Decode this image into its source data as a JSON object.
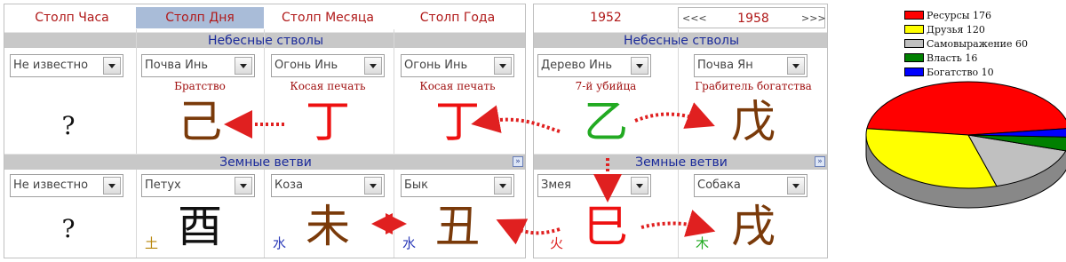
{
  "pillars": [
    {
      "title": "Столп Часа",
      "stem_select": "Не известно",
      "stem_relation": "",
      "stem_glyph": "?",
      "stem_color": "#111111",
      "branch_select": "Не известно",
      "branch_glyph": "?",
      "branch_color": "#111111",
      "element": "",
      "element_color": ""
    },
    {
      "title": "Столп Дня",
      "stem_select": "Почва Инь",
      "stem_relation": "Братство",
      "stem_glyph": "己",
      "stem_color": "#7a3a0a",
      "branch_select": "Петух",
      "branch_glyph": "酉",
      "branch_color": "#111111",
      "element": "土",
      "element_color": "#b8860b"
    },
    {
      "title": "Столп Месяца",
      "stem_select": "Огонь Инь",
      "stem_relation": "Косая печать",
      "stem_glyph": "丁",
      "stem_color": "#ee1111",
      "branch_select": "Коза",
      "branch_glyph": "未",
      "branch_color": "#7a3a0a",
      "element": "水",
      "element_color": "#2a3ab8"
    },
    {
      "title": "Столп Года",
      "stem_select": "Огонь Инь",
      "stem_relation": "Косая печать",
      "stem_glyph": "丁",
      "stem_color": "#ee1111",
      "branch_select": "Бык",
      "branch_glyph": "丑",
      "branch_color": "#7a3a0a",
      "element": "水",
      "element_color": "#2a3ab8"
    }
  ],
  "left_bands": {
    "heavenly": "Небесные стволы",
    "earthly": "Земные ветви"
  },
  "right": {
    "year_a": "1952",
    "year_b": "1958",
    "prev": "<<<",
    "next": ">>>",
    "heavenly": "Небесные стволы",
    "earthly": "Земные ветви",
    "cols": [
      {
        "stem_select": "Дерево Инь",
        "stem_relation": "7-й убийца",
        "stem_glyph": "乙",
        "stem_color": "#22aa22",
        "branch_select": "Змея",
        "branch_glyph": "巳",
        "branch_color": "#ee1111",
        "element": "火",
        "element_color": "#dd2222"
      },
      {
        "stem_select": "Почва Ян",
        "stem_relation": "Грабитель богатства",
        "stem_glyph": "戊",
        "stem_color": "#7a3a0a",
        "branch_select": "Собака",
        "branch_glyph": "戌",
        "branch_color": "#7a3a0a",
        "element": "木",
        "element_color": "#22aa22"
      }
    ]
  },
  "chart_data": {
    "type": "pie",
    "title": "",
    "legend_placement": "top-left",
    "slices": [
      {
        "label": "Ресурсы",
        "value": 176,
        "color": "#ff0000"
      },
      {
        "label": "Друзья",
        "value": 120,
        "color": "#ffff00"
      },
      {
        "label": "Самовыражение",
        "value": 60,
        "color": "#c0c0c0"
      },
      {
        "label": "Власть",
        "value": 16,
        "color": "#008000"
      },
      {
        "label": "Богатство",
        "value": 10,
        "color": "#0000ff"
      }
    ],
    "legend_text": [
      "Ресурсы 176",
      "Друзья 120",
      "Самовыражение 60",
      "Власть 16",
      "Богатство 10"
    ]
  }
}
